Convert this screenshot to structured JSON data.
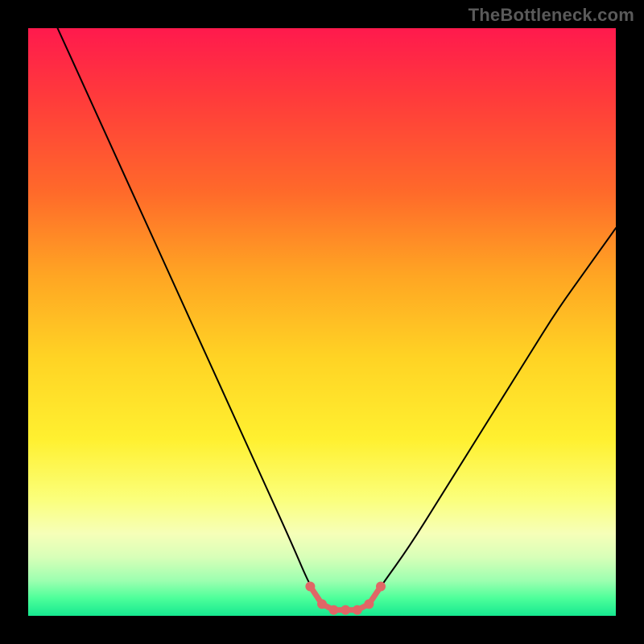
{
  "watermark": "TheBottleneck.com",
  "chart_data": {
    "type": "line",
    "title": "",
    "xlabel": "",
    "ylabel": "",
    "xlim": [
      0,
      100
    ],
    "ylim": [
      0,
      100
    ],
    "grid": false,
    "legend": false,
    "annotations": [],
    "series": [
      {
        "name": "bottleneck-curve",
        "color": "#000000",
        "x": [
          5,
          10,
          15,
          20,
          25,
          30,
          35,
          40,
          45,
          48,
          50,
          52,
          54,
          56,
          58,
          60,
          65,
          70,
          75,
          80,
          85,
          90,
          95,
          100
        ],
        "y": [
          100,
          89,
          78,
          67,
          56,
          45,
          34,
          23,
          12,
          5,
          2,
          1,
          1,
          1,
          2,
          5,
          12,
          20,
          28,
          36,
          44,
          52,
          59,
          66
        ]
      },
      {
        "name": "optimal-zone-markers",
        "color": "#e06666",
        "x": [
          48,
          50,
          52,
          54,
          56,
          58,
          60
        ],
        "y": [
          5,
          2,
          1,
          1,
          1,
          2,
          5
        ]
      }
    ],
    "background_gradient": {
      "top": "#ff1a4d",
      "mid": "#ffe030",
      "bottom": "#16e890"
    }
  }
}
